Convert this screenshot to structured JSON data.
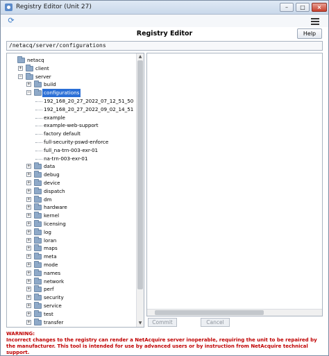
{
  "window": {
    "title": "Registry Editor (Unit 27)",
    "minimize": "–",
    "maximize": "□",
    "close": "×"
  },
  "header": {
    "title": "Registry Editor",
    "help_label": "Help"
  },
  "path": {
    "value": "/netacq/server/configurations"
  },
  "tree": {
    "root": "netacq",
    "client": "client",
    "server": "server",
    "children": [
      {
        "label": "build",
        "expandable": true
      },
      {
        "label": "configurations",
        "expandable": true,
        "selected": true
      },
      {
        "label": "data",
        "expandable": true
      },
      {
        "label": "debug",
        "expandable": true
      },
      {
        "label": "device",
        "expandable": true
      },
      {
        "label": "dispatch",
        "expandable": true
      },
      {
        "label": "dm",
        "expandable": true
      },
      {
        "label": "hardware",
        "expandable": true
      },
      {
        "label": "kernel",
        "expandable": true
      },
      {
        "label": "licensing",
        "expandable": true
      },
      {
        "label": "log",
        "expandable": true
      },
      {
        "label": "loran",
        "expandable": true
      },
      {
        "label": "maps",
        "expandable": true
      },
      {
        "label": "meta",
        "expandable": true
      },
      {
        "label": "mode",
        "expandable": true
      },
      {
        "label": "names",
        "expandable": true
      },
      {
        "label": "network",
        "expandable": true
      },
      {
        "label": "perf",
        "expandable": true
      },
      {
        "label": "security",
        "expandable": true
      },
      {
        "label": "service",
        "expandable": true
      },
      {
        "label": "test",
        "expandable": true
      },
      {
        "label": "transfer",
        "expandable": true
      }
    ],
    "configurations": [
      "192_168_20_27_2022_07_12_51_50",
      "192_168_20_27_2022_09_02_14_51",
      "example",
      "example-web-support",
      "factory default",
      "full-security-pswd-enforce",
      "full_na-trn-003-exr-01",
      "na-trn-003-exr-01"
    ]
  },
  "buttons": {
    "commit": "Commit",
    "cancel": "Cancel"
  },
  "warning": {
    "label": "WARNING:",
    "text": "Incorrect changes to the registry can render a NetAcquire server inoperable, requiring the unit to be repaired by the manufacturer. This tool is intended for use by advanced users or by instruction from NetAcquire technical support."
  }
}
